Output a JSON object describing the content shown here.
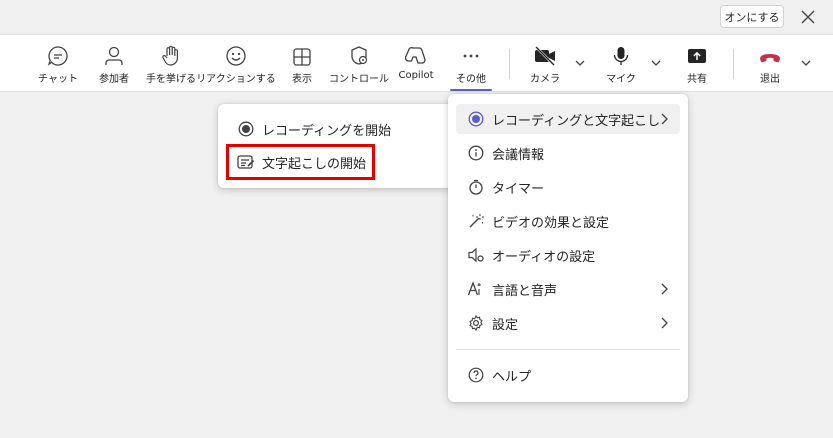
{
  "top": {
    "on_button": "オンにする"
  },
  "toolbar": {
    "items": [
      {
        "label": "チャット",
        "icon": "chat-icon"
      },
      {
        "label": "参加者",
        "icon": "people-icon"
      },
      {
        "label": "手を挙げる",
        "icon": "raise-hand-icon"
      },
      {
        "label": "リアクションする",
        "icon": "smiley-icon"
      },
      {
        "label": "表示",
        "icon": "view-grid-icon"
      },
      {
        "label": "コントロール",
        "icon": "shield-settings-icon"
      },
      {
        "label": "Copilot",
        "icon": "copilot-icon"
      },
      {
        "label": "その他",
        "icon": "more-icon"
      },
      {
        "label": "カメラ",
        "icon": "camera-off-icon"
      },
      {
        "label": "マイク",
        "icon": "mic-icon"
      },
      {
        "label": "共有",
        "icon": "share-icon"
      },
      {
        "label": "退出",
        "icon": "hangup-icon"
      }
    ],
    "hangup_color": "#c4314b",
    "accent": "#5b5fc7"
  },
  "submenu": {
    "items": [
      {
        "label": "レコーディングを開始",
        "icon": "record-icon"
      },
      {
        "label": "文字起こしの開始",
        "icon": "transcript-icon"
      }
    ]
  },
  "more_menu": {
    "items": [
      {
        "label": "レコーディングと文字起こし",
        "icon": "record-active-icon"
      },
      {
        "label": "会議情報",
        "icon": "info-icon"
      },
      {
        "label": "タイマー",
        "icon": "timer-icon"
      },
      {
        "label": "ビデオの効果と設定",
        "icon": "magic-wand-icon"
      },
      {
        "label": "オーディオの設定",
        "icon": "speaker-settings-icon"
      },
      {
        "label": "言語と音声",
        "icon": "language-icon"
      },
      {
        "label": "設定",
        "icon": "gear-icon"
      },
      {
        "label": "ヘルプ",
        "icon": "help-icon"
      }
    ]
  }
}
